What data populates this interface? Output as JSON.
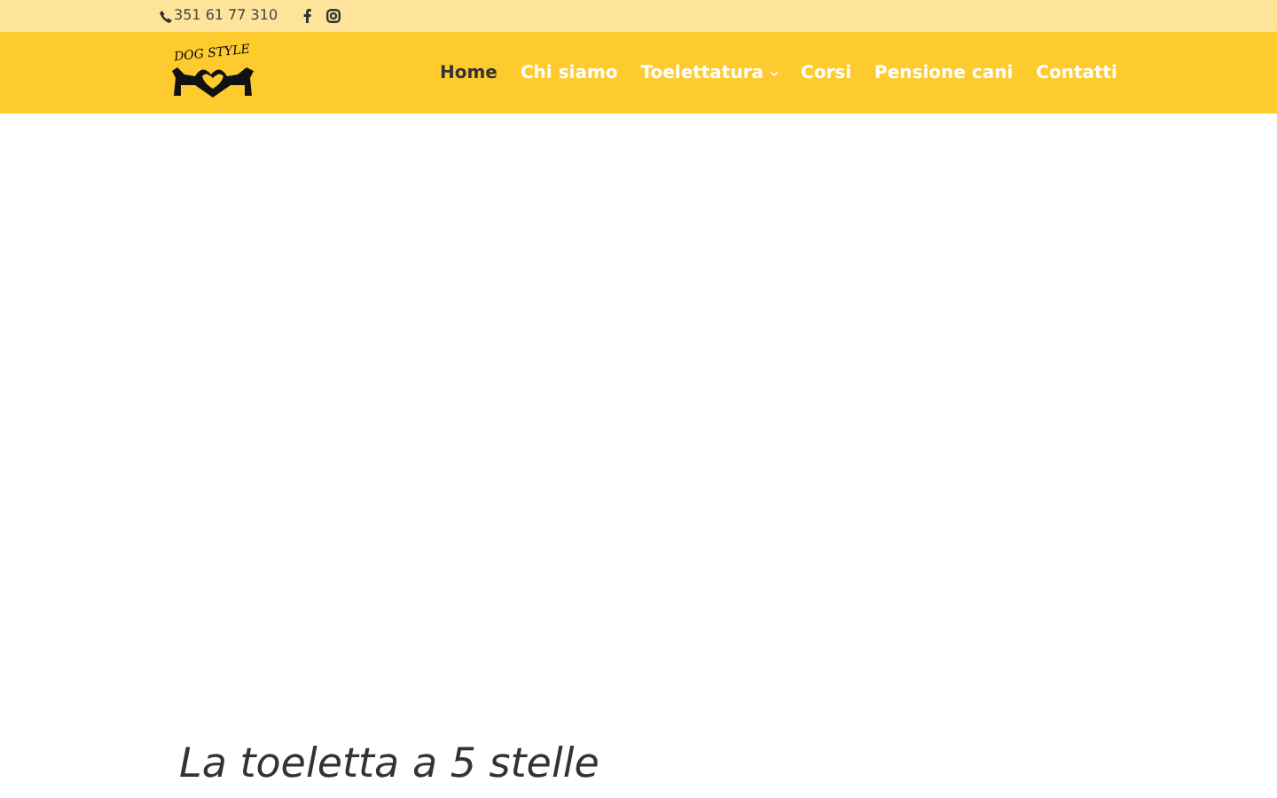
{
  "top_bar": {
    "phone": "351 61 77 310"
  },
  "logo": {
    "text": "DOG STYLE"
  },
  "nav": [
    {
      "label": "Home",
      "selected": true,
      "dropdown": false
    },
    {
      "label": "Chi siamo",
      "selected": false,
      "dropdown": false
    },
    {
      "label": "Toelettatura",
      "selected": false,
      "dropdown": true
    },
    {
      "label": "Corsi",
      "selected": false,
      "dropdown": false
    },
    {
      "label": "Pensione cani",
      "selected": false,
      "dropdown": false
    },
    {
      "label": "Contatti",
      "selected": false,
      "dropdown": false
    }
  ],
  "heading": "La toeletta a 5 stelle"
}
